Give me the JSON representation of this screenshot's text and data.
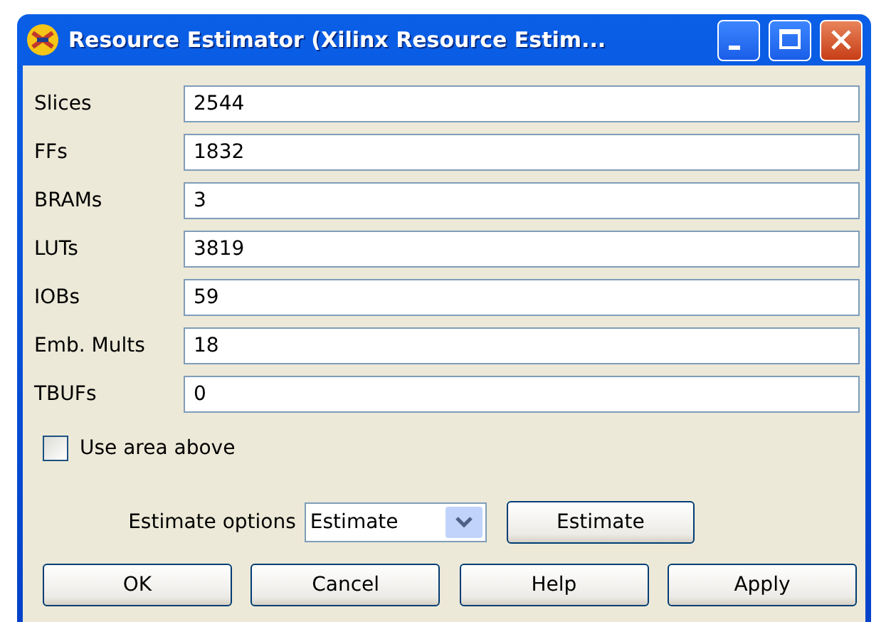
{
  "window": {
    "title": "Resource Estimator (Xilinx Resource Estim..."
  },
  "fields": [
    {
      "label": "Slices",
      "value": "2544"
    },
    {
      "label": "FFs",
      "value": "1832"
    },
    {
      "label": "BRAMs",
      "value": "3"
    },
    {
      "label": "LUTs",
      "value": "3819"
    },
    {
      "label": "IOBs",
      "value": "59"
    },
    {
      "label": "Emb. Mults",
      "value": "18"
    },
    {
      "label": "TBUFs",
      "value": "0"
    }
  ],
  "use_area_above": {
    "label": "Use area above",
    "checked": false
  },
  "estimate_options": {
    "label": "Estimate options",
    "value": "Estimate",
    "button": "Estimate"
  },
  "buttons": [
    "OK",
    "Cancel",
    "Help",
    "Apply"
  ]
}
